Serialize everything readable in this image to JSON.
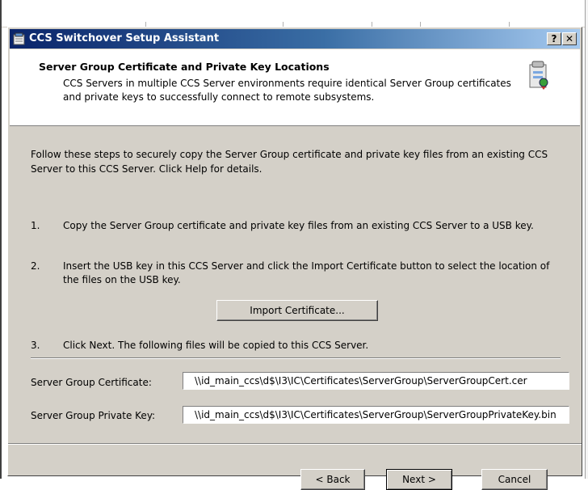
{
  "window": {
    "title": "CCS Switchover Setup Assistant"
  },
  "titlebar_buttons": {
    "help": "?",
    "close": "✕"
  },
  "header": {
    "title": "Server Group Certificate and Private Key Locations",
    "description": "CCS Servers in multiple CCS Server environments require identical Server Group certificates and private keys to successfully connect to remote subsystems."
  },
  "intro": "Follow these steps to securely copy the Server Group certificate and private key files from an existing CCS Server to this CCS Server. Click Help for details.",
  "steps": [
    {
      "num": "1.",
      "text": "Copy the Server Group certificate and private key files from an existing CCS Server to a USB key."
    },
    {
      "num": "2.",
      "text": "Insert the USB key in this CCS Server and click the Import Certificate button to select the location of the files on the USB key."
    },
    {
      "num": "3.",
      "text": "Click Next. The following files will be copied to this CCS Server."
    }
  ],
  "import_button": "Import Certificate...",
  "fields": {
    "certificate": {
      "label": "Server Group Certificate:",
      "value": "\\\\id_main_ccs\\d$\\I3\\IC\\Certificates\\ServerGroup\\ServerGroupCert.cer"
    },
    "private_key": {
      "label": "Server Group Private Key:",
      "value": "\\\\id_main_ccs\\d$\\I3\\IC\\Certificates\\ServerGroup\\ServerGroupPrivateKey.bin"
    }
  },
  "footer": {
    "back": "< Back",
    "next": "Next >",
    "cancel": "Cancel"
  },
  "colors": {
    "title_gradient_start": "#0a246a",
    "title_gradient_end": "#a6caf0",
    "dialog_face": "#d4d0c8"
  }
}
